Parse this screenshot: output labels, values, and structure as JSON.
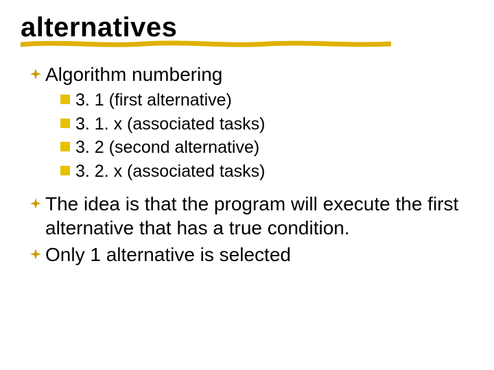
{
  "title": "alternatives",
  "bullets": [
    {
      "text": "Algorithm numbering",
      "sub": [
        "3. 1  (first alternative)",
        "3. 1. x   (associated tasks)",
        "3. 2  (second alternative)",
        "3. 2. x   (associated tasks)"
      ]
    },
    {
      "text": "The idea is that the program will execute the first alternative that has a true condition."
    },
    {
      "text": "Only 1 alternative is selected"
    }
  ],
  "colors": {
    "accent": "#d9a400",
    "subBullet": "#e6c200"
  }
}
